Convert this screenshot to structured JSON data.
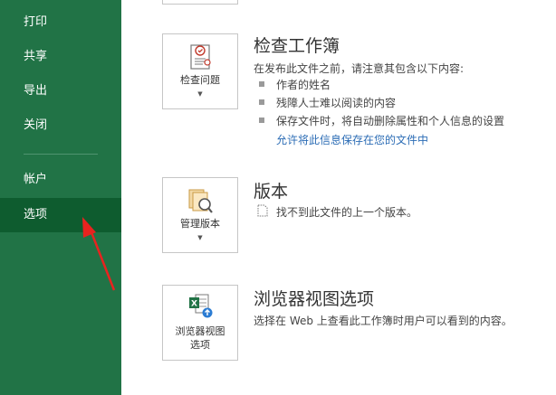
{
  "sidebar": {
    "items": [
      {
        "label": "打印"
      },
      {
        "label": "共享"
      },
      {
        "label": "导出"
      },
      {
        "label": "关闭"
      },
      {
        "label": "帐户"
      },
      {
        "label": "选项"
      }
    ],
    "active_color": "#0e5c2f",
    "background_color": "#217346"
  },
  "inspect": {
    "button_label": "检查问题",
    "title": "检查工作簿",
    "description": "在发布此文件之前，请注意其包含以下内容:",
    "bullets": [
      "作者的姓名",
      "残障人士难以阅读的内容",
      "保存文件时，将自动删除属性和个人信息的设置"
    ],
    "link": "允许将此信息保存在您的文件中"
  },
  "versions": {
    "button_label": "管理版本",
    "title": "版本",
    "description": "找不到此文件的上一个版本。"
  },
  "browser": {
    "button_label_line1": "浏览器视图",
    "button_label_line2": "选项",
    "title": "浏览器视图选项",
    "description": "选择在 Web 上查看此工作簿时用户可以看到的内容。"
  },
  "annotation": {
    "arrow_color": "#e8231f"
  }
}
